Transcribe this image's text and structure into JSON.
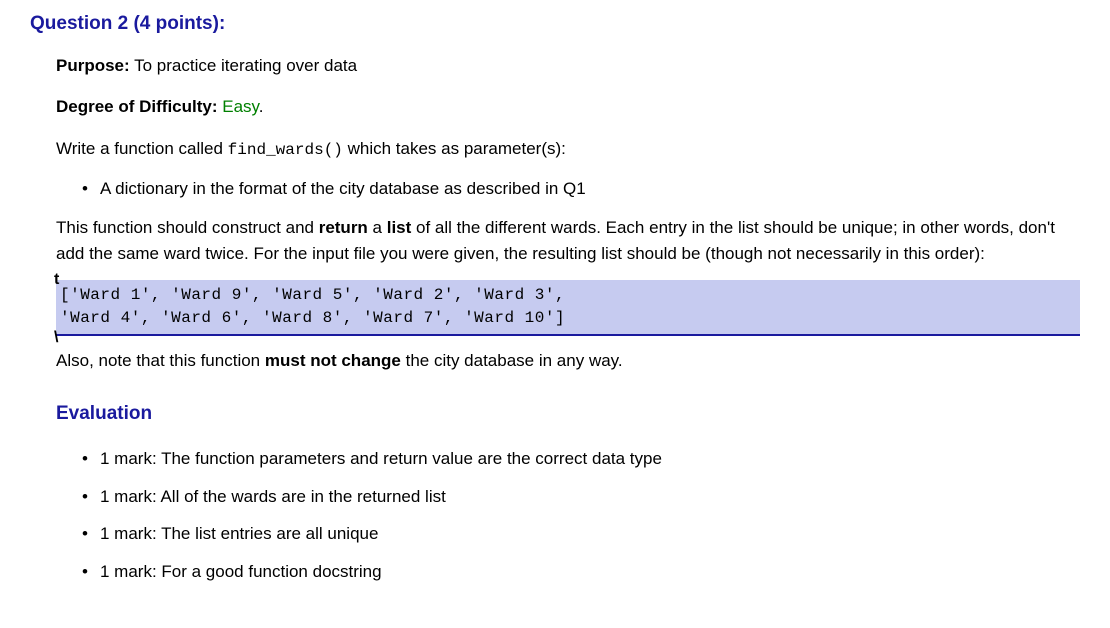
{
  "question": {
    "title": "Question 2 (4 points):",
    "purpose_label": "Purpose:",
    "purpose_text": "  To practice iterating over data",
    "difficulty_label": "Degree of Difficulty:",
    "difficulty_value": "  Easy",
    "difficulty_period": ".",
    "intro_prefix": "Write a function called ",
    "intro_code": "find_wards()",
    "intro_suffix": " which takes as parameter(s):",
    "params": [
      "A dictionary in the format of the city database as described in Q1"
    ],
    "desc_part1": "This function should construct and ",
    "desc_bold1": "return",
    "desc_part2": " a ",
    "desc_bold2": "list",
    "desc_part3": " of all the different wards. Each entry in the list should be unique; in other words, don't add the same ward twice. For the input file you were given, the resulting list should be (though not necessarily in this order):",
    "code_output": "['Ward 1', 'Ward 9', 'Ward 5', 'Ward 2', 'Ward 3',\n'Ward 4', 'Ward 6', 'Ward 8', 'Ward 7', 'Ward 10']",
    "note_part1": "Also, note that this function ",
    "note_bold": "must not change",
    "note_part2": " the city database in any way.",
    "evaluation_heading": "Evaluation",
    "evaluation_items": [
      "1 mark: The function parameters and return value are the correct data type",
      "1 mark: All of the wards are in the returned list",
      "1 mark: The list entries are all unique",
      "1 mark: For a good function docstring"
    ]
  },
  "selection_markers": {
    "top": "t",
    "bottom": "\\"
  }
}
